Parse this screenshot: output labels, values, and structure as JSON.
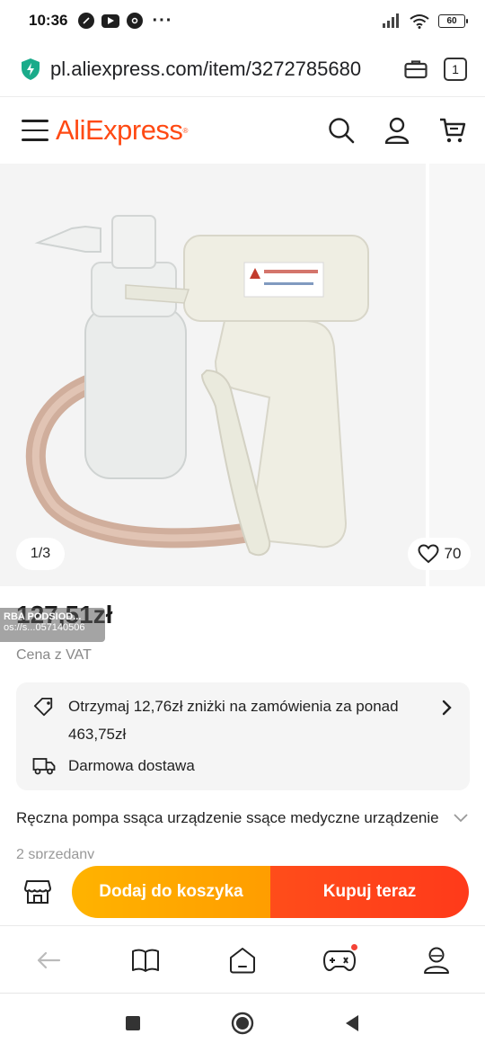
{
  "status_bar": {
    "time": "10:36",
    "battery": "60"
  },
  "browser": {
    "url": "pl.aliexpress.com/item/3272785680",
    "tab_count": "1"
  },
  "header": {
    "logo": "AliExpress"
  },
  "gallery": {
    "counter": "1/3",
    "favorites": "70"
  },
  "price": {
    "value": "127,51zł",
    "vat_note": "Cena z VAT"
  },
  "overlay_tag": {
    "line1": "RBA PODSIOD...",
    "line2": "os://s...057140506"
  },
  "offers": {
    "coupon_text": "Otrzymaj 12,76zł zniżki na zamówienia za ponad 463,75zł",
    "shipping_text": "Darmowa dostawa"
  },
  "product": {
    "title": "Ręczna pompa ssąca urządzenie ssące medyczne urządzenie",
    "sold": "2 sprzedany"
  },
  "actions": {
    "add_to_cart": "Dodaj do koszyka",
    "buy_now": "Kupuj teraz"
  },
  "colors": {
    "brand": "#ff4a14",
    "cart_button": "#ffa800",
    "buy_button": "#ff4219"
  },
  "icons": [
    "lightning-shield-icon",
    "briefcase-icon",
    "menu-icon",
    "search-icon",
    "user-icon",
    "cart-icon",
    "heart-icon",
    "tag-icon",
    "truck-icon",
    "chevron-right-icon",
    "chevron-down-icon",
    "store-icon",
    "back-icon",
    "book-icon",
    "home-icon",
    "gamepad-icon",
    "profile-icon"
  ]
}
